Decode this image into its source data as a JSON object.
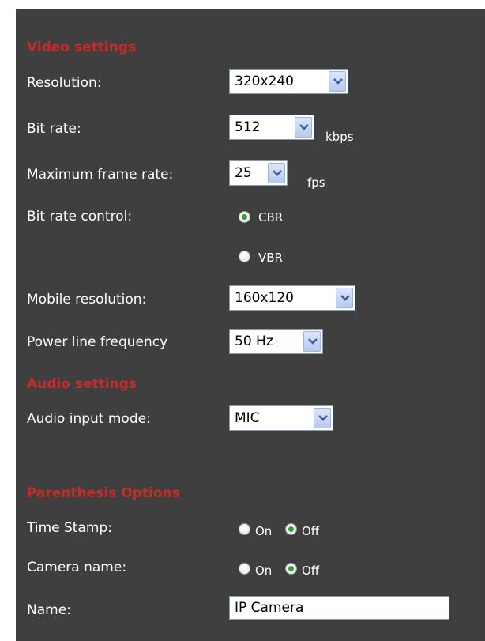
{
  "video_settings": {
    "heading": "Video settings",
    "resolution": {
      "label": "Resolution:",
      "value": "320x240"
    },
    "bit_rate": {
      "label": "Bit rate:",
      "value": "512",
      "unit": "kbps"
    },
    "max_frame_rate": {
      "label": "Maximum frame rate:",
      "value": "25",
      "unit": "fps"
    },
    "bit_rate_control": {
      "label": "Bit rate control:",
      "options": [
        {
          "label": "CBR",
          "selected": true
        },
        {
          "label": "VBR",
          "selected": false
        }
      ]
    },
    "mobile_resolution": {
      "label": "Mobile resolution:",
      "value": "160x120"
    },
    "power_line_frequency": {
      "label": "Power line frequency",
      "value": "50 Hz"
    }
  },
  "audio_settings": {
    "heading": "Audio settings",
    "audio_input_mode": {
      "label": "Audio input mode:",
      "value": "MIC"
    }
  },
  "parenthesis_options": {
    "heading": "Parenthesis Options",
    "time_stamp": {
      "label": "Time Stamp:",
      "on_label": "On",
      "off_label": "Off",
      "selected": "Off"
    },
    "camera_name": {
      "label": "Camera name:",
      "on_label": "On",
      "off_label": "Off",
      "selected": "Off"
    },
    "name": {
      "label": "Name:",
      "value": "IP Camera"
    }
  },
  "colors": {
    "panel_background": "#3f3f3f",
    "section_heading": "#c62b2b",
    "label_text": "#ffffff",
    "radio_checked": "#2ea52e"
  }
}
